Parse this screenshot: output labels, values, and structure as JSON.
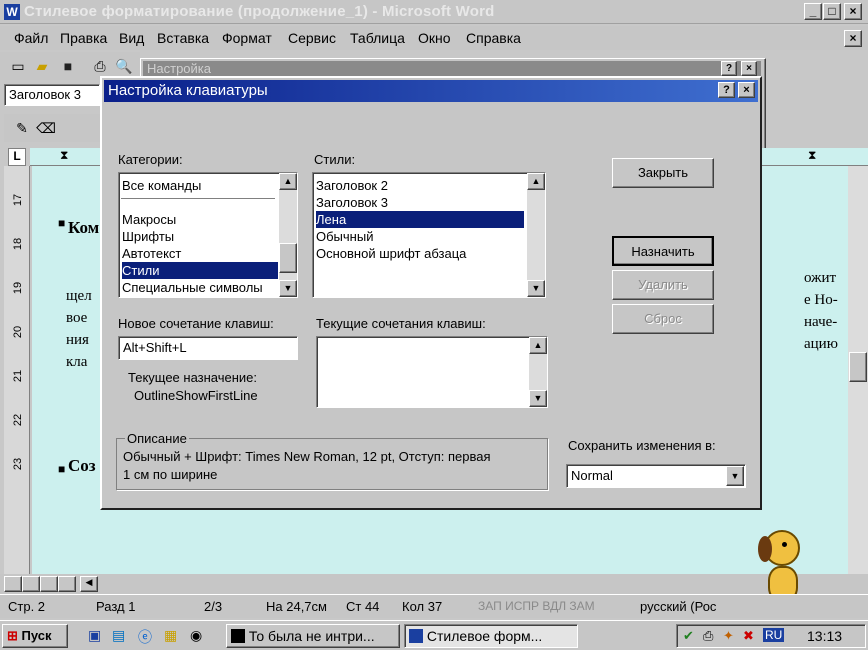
{
  "window": {
    "title": "Стилевое форматирование (продолжение_1) - Microsoft Word"
  },
  "menu": [
    "Файл",
    "Правка",
    "Вид",
    "Вставка",
    "Формат",
    "Сервис",
    "Таблица",
    "Окно",
    "Справка"
  ],
  "toolbar": {
    "style_box": "Заголовок 3"
  },
  "behind_dialog": {
    "title": "Настройка"
  },
  "ruler_numbers": [
    "17",
    "18",
    "19",
    "20",
    "21",
    "22",
    "23"
  ],
  "document": {
    "lines": [
      "Ком",
      "щел",
      "вое",
      "ния",
      "кла",
      "Соз"
    ],
    "right_lines": [
      "ожит",
      "е Но-",
      "наче-",
      "ацию"
    ]
  },
  "dialog": {
    "title": "Настройка клавиатуры",
    "categories_label": "Категории:",
    "categories": [
      "Все команды",
      "Макросы",
      "Шрифты",
      "Автотекст",
      "Стили",
      "Специальные символы"
    ],
    "categories_selected": "Стили",
    "styles_label": "Стили:",
    "styles": [
      "Заголовок 2",
      "Заголовок 3",
      "Лена",
      "Обычный",
      "Основной шрифт абзаца"
    ],
    "styles_selected": "Лена",
    "new_shortcut_label": "Новое сочетание клавиш:",
    "new_shortcut_value": "Alt+Shift+L",
    "current_shortcuts_label": "Текущие сочетания клавиш:",
    "current_assignment_label": "Текущее назначение:",
    "current_assignment_value": "OutlineShowFirstLine",
    "description_label": "Описание",
    "description_text_1": "Обычный + Шрифт: Times New Roman, 12 pt, Отступ: первая",
    "description_text_2": "1 см по ширине",
    "save_in_label": "Сохранить изменения в:",
    "save_in_value": "Normal",
    "close_button": "Закрыть",
    "assign_button": "Назначить",
    "remove_button": "Удалить",
    "reset_button": "Сброс"
  },
  "status": {
    "page": "Стр. 2",
    "section": "Разд 1",
    "pages": "2/3",
    "at": "На 24,7см",
    "line": "Ст 44",
    "col": "Кол 37",
    "modes": "ЗАП  ИСПР  ВДЛ  ЗАМ",
    "language": "русский (Рос"
  },
  "taskbar": {
    "start": "Пуск",
    "task1": "То была не интри...",
    "task2": "Стилевое форм...",
    "lang": "RU",
    "clock": "13:13"
  }
}
